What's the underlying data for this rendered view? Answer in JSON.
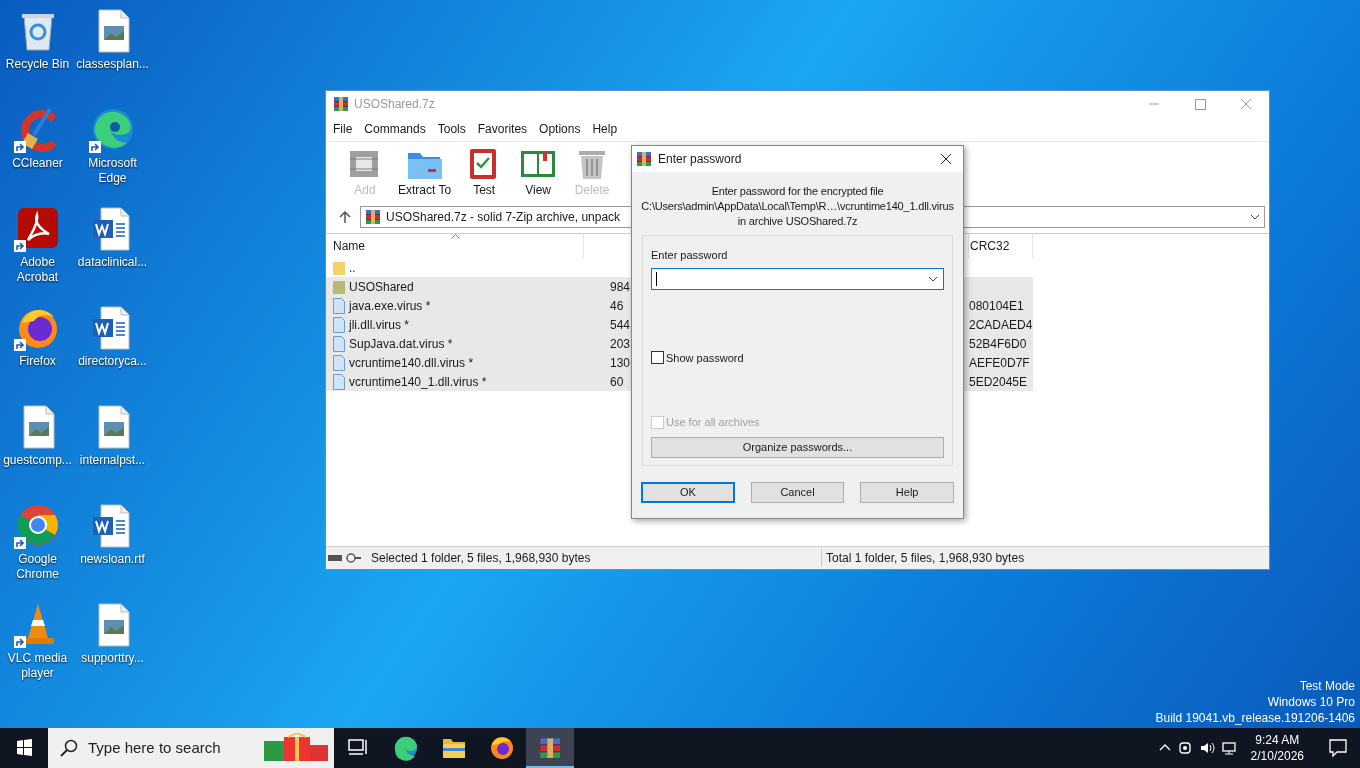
{
  "desktop_icons": [
    {
      "label": "Recycle Bin",
      "kind": "recycle",
      "shortcut": false
    },
    {
      "label": "classesplan...",
      "kind": "image",
      "shortcut": false
    },
    {
      "label": "CCleaner",
      "kind": "ccleaner",
      "shortcut": true
    },
    {
      "label": "Microsoft Edge",
      "kind": "edge",
      "shortcut": true
    },
    {
      "label": "Adobe Acrobat",
      "kind": "acrobat",
      "shortcut": true
    },
    {
      "label": "dataclinical...",
      "kind": "word",
      "shortcut": false
    },
    {
      "label": "Firefox",
      "kind": "firefox",
      "shortcut": true
    },
    {
      "label": "directoryca...",
      "kind": "word",
      "shortcut": false
    },
    {
      "label": "guestcomp...",
      "kind": "image",
      "shortcut": false
    },
    {
      "label": "internalpst...",
      "kind": "image",
      "shortcut": false
    },
    {
      "label": "Google Chrome",
      "kind": "chrome",
      "shortcut": true
    },
    {
      "label": "newsloan.rtf",
      "kind": "word",
      "shortcut": false
    },
    {
      "label": "VLC media player",
      "kind": "vlc",
      "shortcut": true
    },
    {
      "label": "supporttry...",
      "kind": "image",
      "shortcut": false
    }
  ],
  "archiver_window": {
    "title": "USOShared.7z",
    "menu": [
      "File",
      "Commands",
      "Tools",
      "Favorites",
      "Options",
      "Help"
    ],
    "toolbar": [
      {
        "label": "Add",
        "kind": "add",
        "disabled": true
      },
      {
        "label": "Extract To",
        "kind": "extract",
        "disabled": false
      },
      {
        "label": "Test",
        "kind": "test",
        "disabled": false
      },
      {
        "label": "View",
        "kind": "view",
        "disabled": false
      },
      {
        "label": "Delete",
        "kind": "delete",
        "disabled": true
      }
    ],
    "address": "USOShared.7z - solid 7-Zip archive, unpack",
    "columns": [
      "Name",
      "CRC32"
    ],
    "rows": [
      {
        "name": "..",
        "kind": "parent",
        "size": "",
        "crc": "",
        "selected": false
      },
      {
        "name": "USOShared",
        "kind": "folder",
        "size": "984",
        "crc": "",
        "selected": true
      },
      {
        "name": "java.exe.virus *",
        "kind": "file",
        "size": "46",
        "crc": "080104E1",
        "selected": true
      },
      {
        "name": "jli.dll.virus *",
        "kind": "file",
        "size": "544",
        "crc": "2CADAED4",
        "selected": true
      },
      {
        "name": "SupJava.dat.virus *",
        "kind": "file",
        "size": "203",
        "crc": "52B4F6D0",
        "selected": true
      },
      {
        "name": "vcruntime140.dll.virus *",
        "kind": "file",
        "size": "130",
        "crc": "AEFE0D7F",
        "selected": true
      },
      {
        "name": "vcruntime140_1.dll.virus *",
        "kind": "file",
        "size": "60",
        "crc": "5ED2045E",
        "selected": true
      }
    ],
    "status_left": "Selected 1 folder, 5 files, 1,968,930 bytes",
    "status_right": "Total 1 folder, 5 files, 1,968,930 bytes"
  },
  "password_dialog": {
    "title": "Enter password",
    "message": [
      "Enter password for the encrypted file",
      "C:\\Users\\admin\\AppData\\Local\\Temp\\R…\\vcruntime140_1.dll.virus",
      "in archive USOShared.7z"
    ],
    "field_label": "Enter password",
    "checkboxes": [
      {
        "label": "Show password",
        "checked": false,
        "disabled": false
      },
      {
        "label": "Use for all archives",
        "checked": false,
        "disabled": true
      }
    ],
    "organize_button": "Organize passwords...",
    "buttons": [
      {
        "label": "OK",
        "default": true
      },
      {
        "label": "Cancel",
        "default": false
      },
      {
        "label": "Help",
        "default": false
      }
    ]
  },
  "os_watermark": [
    "Test Mode",
    "Windows 10 Pro",
    "Build 19041.vb_release.191206-1406"
  ],
  "taskbar": {
    "search_placeholder": "Type here to search",
    "apps": [
      {
        "kind": "taskview",
        "active": false
      },
      {
        "kind": "edge",
        "active": false
      },
      {
        "kind": "explorer",
        "active": false
      },
      {
        "kind": "firefox",
        "active": false
      },
      {
        "kind": "archiver",
        "active": true
      }
    ],
    "time": "9:24 AM",
    "date": "2/10/2026"
  }
}
